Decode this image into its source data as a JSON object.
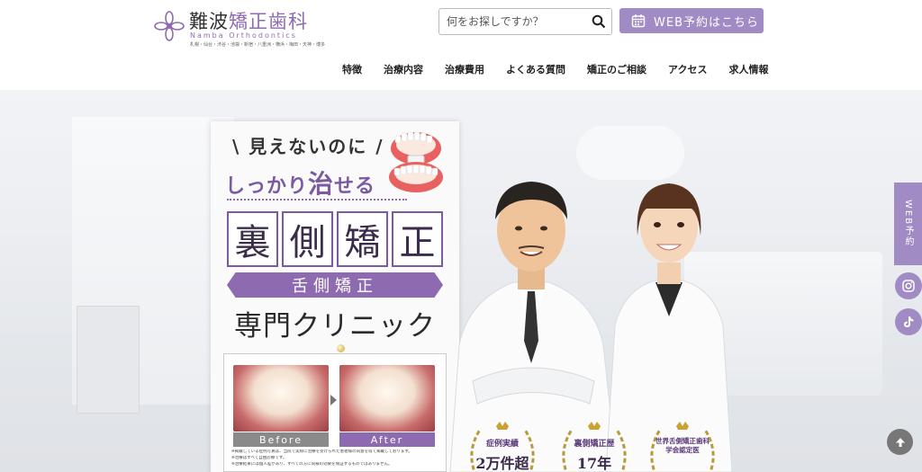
{
  "header": {
    "logo": {
      "name_a": "難波",
      "name_b": "矯正歯科",
      "name_en": "Namba Orthodontics",
      "locations": "札幌・仙台・渋谷・池袋・新宿・八重洲・横浜・梅田・天神・博多"
    },
    "search": {
      "placeholder": "何をお探しですか？"
    },
    "web_button": "WEB予約はこちら",
    "nav": [
      "特徴",
      "治療内容",
      "治療費用",
      "よくある質問",
      "矯正のご相談",
      "アクセス",
      "求人情報"
    ]
  },
  "hero": {
    "tagline_1": "見えないのに",
    "tagline_2a": "しっかり",
    "tagline_2b": "治",
    "tagline_2c": "せる",
    "title_chars": [
      "裏",
      "側",
      "矯",
      "正"
    ],
    "subtitle": "舌側矯正",
    "clinic": "専門クリニック",
    "before_label": "Before",
    "after_label": "After",
    "notes": [
      "※掲載している症例写真は、当院で実際に治療を受けられた患者様の同意を得て掲載しております。",
      "※治療はすべて自由診療です。",
      "※治療結果には個人差があり、すべての方に同様の効果を保証するものではありません。"
    ],
    "badges": [
      {
        "label": "症例実績",
        "value": "2万件超"
      },
      {
        "label": "裏側矯正歴",
        "value": "17年"
      },
      {
        "label": "世界舌側矯正歯科学会認定医",
        "value": ""
      }
    ]
  },
  "side": {
    "web_tab": "WEB予約",
    "instagram_icon": "instagram-icon",
    "tiktok_icon": "tiktok-icon",
    "totop_icon": "arrow-up-icon"
  },
  "colors": {
    "accent": "#a18bc4",
    "brand": "#8e6bb0"
  }
}
